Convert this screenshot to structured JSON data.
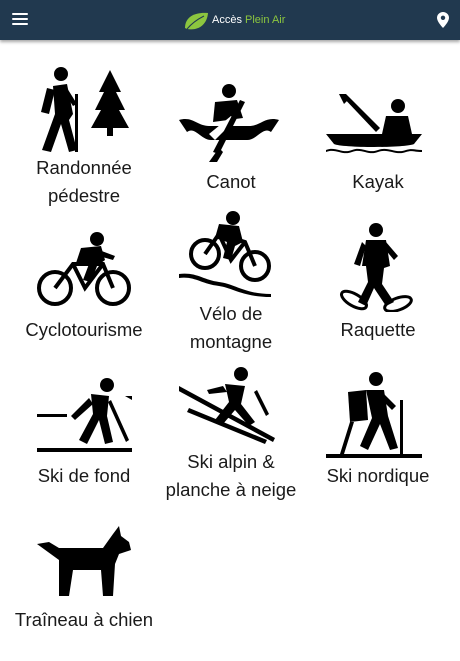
{
  "app": {
    "brand_part1": "Accès",
    "brand_part2": "Plein Air",
    "accent_color": "#8cc63f",
    "header_color": "#21394f"
  },
  "header": {
    "menu_icon": "hamburger-menu-icon",
    "logo_icon": "leaf-logo-icon",
    "location_icon": "map-pin-icon"
  },
  "activities": [
    {
      "label": "Randonnée\npédestre",
      "icon": "hiking-icon"
    },
    {
      "label": "Canot",
      "icon": "canoe-icon"
    },
    {
      "label": "Kayak",
      "icon": "kayak-icon"
    },
    {
      "label": "Cyclotourisme",
      "icon": "cycling-icon"
    },
    {
      "label": "Vélo de\nmontagne",
      "icon": "mountain-bike-icon"
    },
    {
      "label": "Raquette",
      "icon": "snowshoe-icon"
    },
    {
      "label": "Ski de fond",
      "icon": "cross-country-ski-icon"
    },
    {
      "label": "Ski alpin &\nplanche à neige",
      "icon": "alpine-ski-icon"
    },
    {
      "label": "Ski nordique",
      "icon": "nordic-ski-icon"
    },
    {
      "label": "Traîneau à chien",
      "icon": "dog-sled-icon"
    }
  ]
}
